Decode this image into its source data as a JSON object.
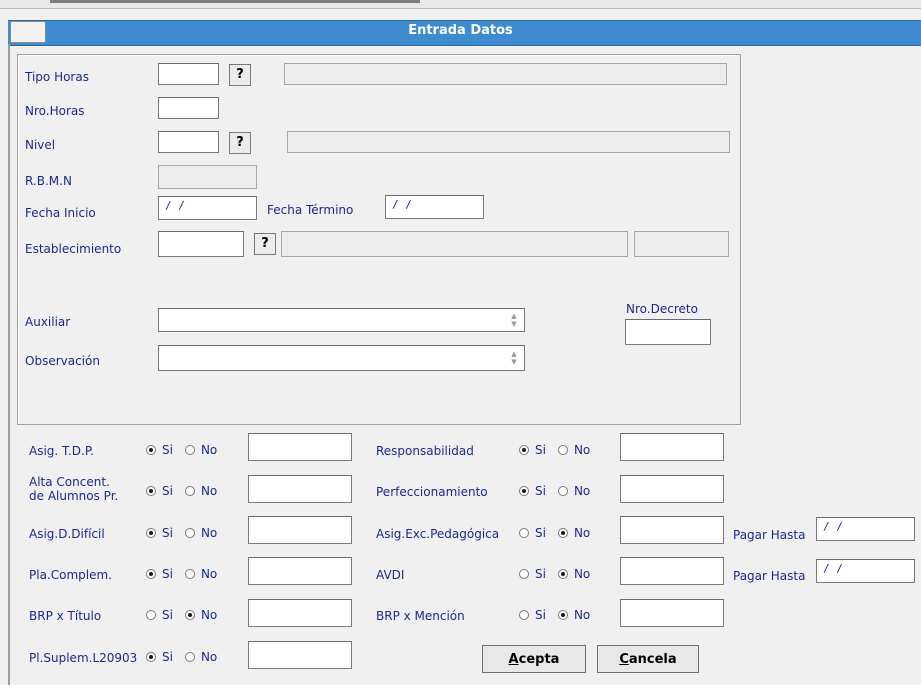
{
  "window": {
    "title": "Entrada Datos"
  },
  "icons": {
    "help": "question-mark-icon"
  },
  "form": {
    "tipo_horas": {
      "label": "Tipo Horas",
      "code": "",
      "help": "?",
      "desc": ""
    },
    "nro_horas": {
      "label": "Nro.Horas",
      "value": ""
    },
    "nivel": {
      "label": "Nivel",
      "code": "",
      "help": "?",
      "desc": ""
    },
    "rbmn": {
      "label": "R.B.M.N",
      "value": ""
    },
    "fecha_inicio": {
      "label": "Fecha Inicio",
      "value": " / /"
    },
    "fecha_termino": {
      "label": "Fecha Término",
      "value": " / /"
    },
    "establecimiento": {
      "label": "Establecimiento",
      "code": "",
      "help": "?",
      "desc": "",
      "extra": ""
    },
    "auxiliar": {
      "label": "Auxiliar",
      "value": ""
    },
    "observacion": {
      "label": "Observación",
      "value": ""
    },
    "nro_decreto": {
      "label": "Nro.Decreto",
      "value": ""
    }
  },
  "options": {
    "si": "Si",
    "no": "No"
  },
  "asignaciones_left": [
    {
      "label": "Asig. T.D.P.",
      "selected": "si",
      "value": ""
    },
    {
      "label": "Alta Concent.",
      "label2": "de Alumnos Pr.",
      "selected": "si",
      "value": ""
    },
    {
      "label": "Asig.D.Difícil",
      "selected": "si",
      "value": ""
    },
    {
      "label": "Pla.Complem.",
      "selected": "si",
      "value": ""
    },
    {
      "label": "BRP x Título",
      "selected": "no",
      "value": ""
    },
    {
      "label": "Pl.Suplem.L20903",
      "selected": "si",
      "value": ""
    }
  ],
  "asignaciones_right": [
    {
      "label": "Responsabilidad",
      "selected": "si",
      "value": ""
    },
    {
      "label": "Perfeccionamiento",
      "selected": "si",
      "value": ""
    },
    {
      "label": "Asig.Exc.Pedagógica",
      "selected": "no",
      "value": ""
    },
    {
      "label": "AVDI",
      "selected": "no",
      "value": ""
    },
    {
      "label": "BRP x Mención",
      "selected": "no",
      "value": ""
    }
  ],
  "pagar_hasta": [
    {
      "label": "Pagar Hasta",
      "value": " / /"
    },
    {
      "label": "Pagar Hasta",
      "value": " / /"
    }
  ],
  "buttons": {
    "acepta": {
      "mnemonic": "A",
      "rest": "cepta"
    },
    "cancela": {
      "mnemonic": "C",
      "rest": "ancela"
    }
  }
}
